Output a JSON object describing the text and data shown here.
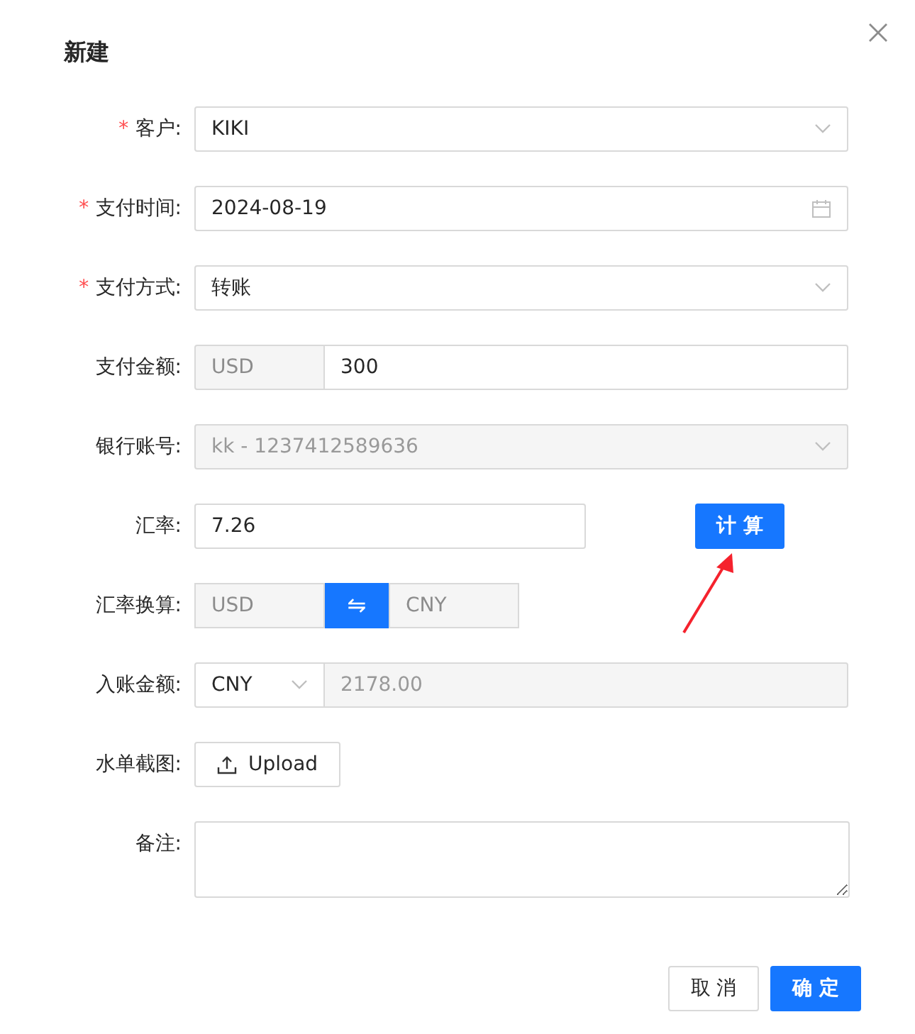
{
  "title": "新建",
  "fields": [
    {
      "kind": "select",
      "label": "客户:",
      "required_mark": "*",
      "value": "KIKI",
      "disabled": false
    },
    {
      "kind": "date",
      "label": "支付时间:",
      "required_mark": "*",
      "value": "2024-08-19",
      "disabled": false
    },
    {
      "kind": "select",
      "label": "支付方式:",
      "required_mark": "*",
      "value": "转账",
      "disabled": false
    },
    {
      "kind": "addon-input",
      "label": "支付金额:",
      "addon": "USD",
      "value": "300",
      "disabled": false
    },
    {
      "kind": "select",
      "label": "银行账号:",
      "value": "kk - 1237412589636",
      "disabled": true
    },
    {
      "kind": "input-button",
      "label": "汇率:",
      "value": "7.26",
      "button": "计 算"
    },
    {
      "kind": "converter",
      "label": "汇率换算:",
      "from": "USD",
      "swap_symbol": "⇋",
      "to": "CNY",
      "disabled": true
    },
    {
      "kind": "select-input",
      "label": "入账金额:",
      "currency": "CNY",
      "value": "2178.00",
      "disabled": true
    },
    {
      "kind": "upload",
      "label": "水单截图:",
      "button": "Upload"
    },
    {
      "kind": "textarea",
      "label": "备注:"
    }
  ],
  "footer": {
    "cancel": "取 消",
    "ok": "确 定"
  }
}
